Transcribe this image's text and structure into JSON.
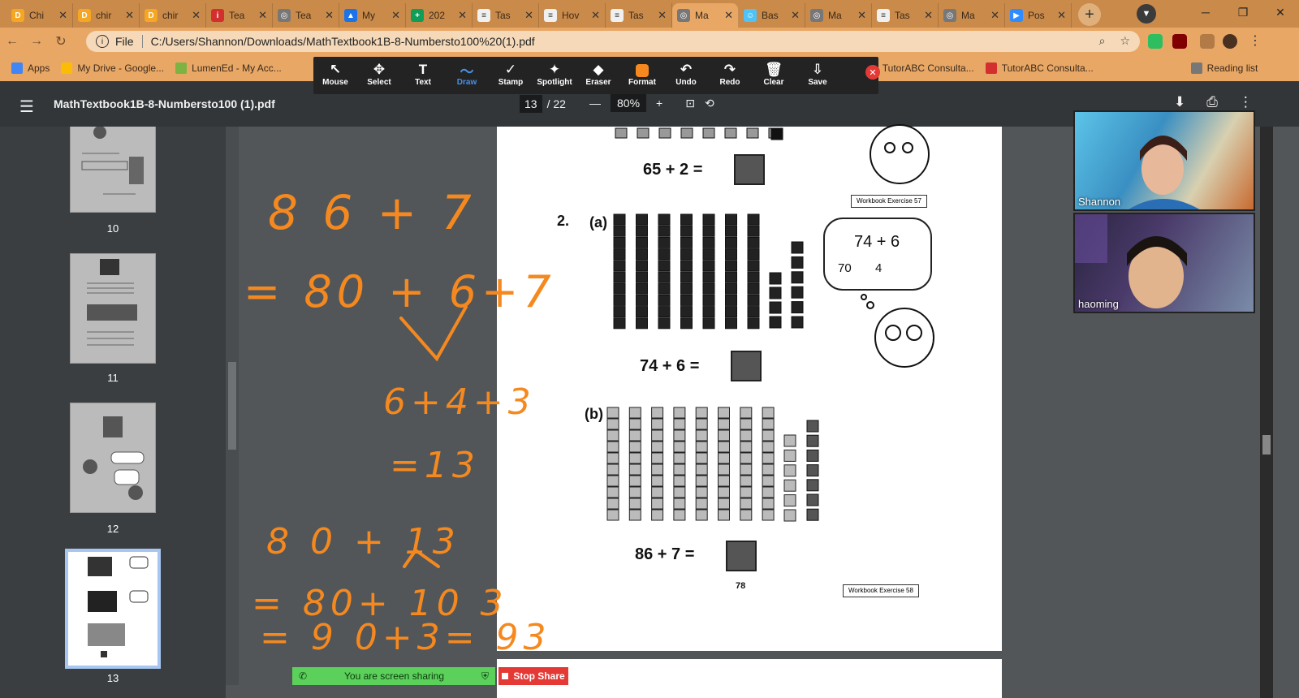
{
  "browser": {
    "tabs": [
      {
        "label": "Chi",
        "fav_color": "#f5a623",
        "fav_glyph": "D"
      },
      {
        "label": "chir",
        "fav_color": "#f5a623",
        "fav_glyph": "D"
      },
      {
        "label": "chir",
        "fav_color": "#f5a623",
        "fav_glyph": "D"
      },
      {
        "label": "Tea",
        "fav_color": "#d32f2f",
        "fav_glyph": "i"
      },
      {
        "label": "Tea",
        "fav_color": "#777777",
        "fav_glyph": "◎"
      },
      {
        "label": "My",
        "fav_color": "#1a73e8",
        "fav_glyph": "▲"
      },
      {
        "label": "202",
        "fav_color": "#0f9d58",
        "fav_glyph": "+"
      },
      {
        "label": "Tas",
        "fav_color": "#f0f0f0",
        "fav_glyph": "≡"
      },
      {
        "label": "Hov",
        "fav_color": "#f0f0f0",
        "fav_glyph": "≡"
      },
      {
        "label": "Tas",
        "fav_color": "#f0f0f0",
        "fav_glyph": "≡"
      },
      {
        "label": "Ma",
        "fav_color": "#777777",
        "fav_glyph": "◎",
        "active": true
      },
      {
        "label": "Bas",
        "fav_color": "#4fc3f7",
        "fav_glyph": "☺"
      },
      {
        "label": "Ma",
        "fav_color": "#777777",
        "fav_glyph": "◎"
      },
      {
        "label": "Tas",
        "fav_color": "#f0f0f0",
        "fav_glyph": "≡"
      },
      {
        "label": "Ma",
        "fav_color": "#777777",
        "fav_glyph": "◎"
      },
      {
        "label": "Pos",
        "fav_color": "#2d8cff",
        "fav_glyph": "▶"
      }
    ],
    "address": {
      "file_label": "File",
      "url": "C:/Users/Shannon/Downloads/MathTextbook1B-8-Numbersto100%20(1).pdf"
    },
    "bookmarks": [
      {
        "label": "Apps",
        "color": "#4285f4"
      },
      {
        "label": "My Drive - Google...",
        "color": "#fbbc05"
      },
      {
        "label": "LumenEd - My Acc...",
        "color": "#7cb342"
      },
      {
        "label": "TutorABC Consulta...",
        "color": "#d32f2f"
      },
      {
        "label": "TutorABC Consulta...",
        "color": "#d32f2f"
      },
      {
        "label": "Reading list",
        "color": "#777777"
      }
    ]
  },
  "annotation_toolbar": {
    "tools": [
      {
        "label": "Mouse",
        "icon": "↖"
      },
      {
        "label": "Select",
        "icon": "✥"
      },
      {
        "label": "Text",
        "icon": "T"
      },
      {
        "label": "Draw",
        "icon": "〜",
        "active": true
      },
      {
        "label": "Stamp",
        "icon": "✓"
      },
      {
        "label": "Spotlight",
        "icon": "✦"
      },
      {
        "label": "Eraser",
        "icon": "◆"
      },
      {
        "label": "Format",
        "icon": "format"
      },
      {
        "label": "Undo",
        "icon": "↶"
      },
      {
        "label": "Redo",
        "icon": "↷"
      },
      {
        "label": "Clear",
        "icon": "🗑"
      },
      {
        "label": "Save",
        "icon": "⇩"
      }
    ],
    "close_icon": "✕"
  },
  "pdf": {
    "title": "MathTextbook1B-8-Numbersto100 (1).pdf",
    "current_page": "13",
    "total_pages": "/ 22",
    "zoom": "80%",
    "thumbnails": [
      {
        "label": "10"
      },
      {
        "label": "11"
      },
      {
        "label": "12"
      },
      {
        "label": "13"
      }
    ],
    "content": {
      "eq1": "65  +  2  =",
      "q2_label": "2.",
      "qa_label": "(a)",
      "thought_main": "74  +  6",
      "thought_left": "70",
      "thought_right": "4",
      "eq2": "74  +  6  =",
      "qb_label": "(b)",
      "eq3": "86  +  7  =",
      "page_number": "78",
      "workbook1": "Workbook Exercise 57",
      "workbook2": "Workbook Exercise 58"
    },
    "annotation": {
      "color": "#f5891f",
      "lines": [
        "8 6 + 7",
        "= 80 + 6+7",
        "6+4+3",
        "=13",
        "8 0 + 13",
        "= 80+ 10 3",
        "= 9 0+3= 93"
      ]
    }
  },
  "video": {
    "participants": [
      {
        "name": "Shannon"
      },
      {
        "name": "haoming"
      }
    ]
  },
  "screenshare": {
    "status": "You are screen sharing",
    "stop_label": "Stop Share"
  }
}
